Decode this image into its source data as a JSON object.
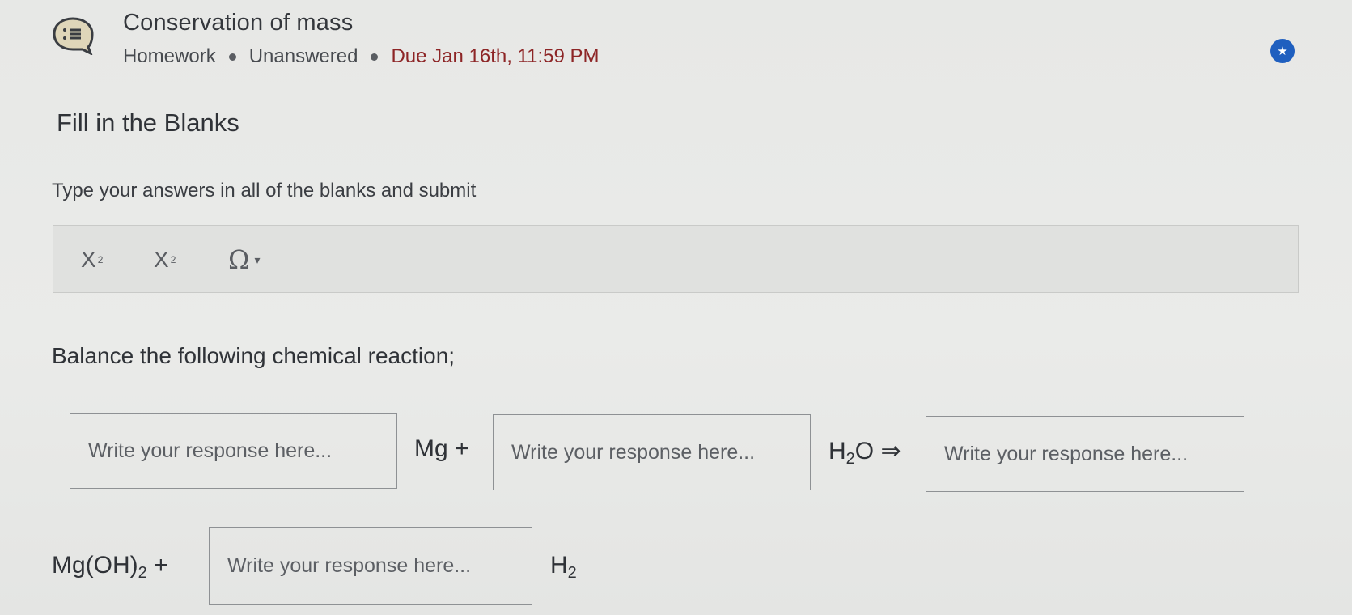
{
  "header": {
    "icon": "question-list-icon",
    "title": "Conservation of mass",
    "type": "Homework",
    "status": "Unanswered",
    "due": "Due Jan 16th, 11:59 PM",
    "star_icon": "star-icon",
    "due_color": "#8d2526",
    "accent_color": "#1f5fbf"
  },
  "section_title": "Fill in the Blanks",
  "instructions": "Type your answers in all of the blanks and submit",
  "toolbar": {
    "subscript_label": "X",
    "subscript_mark": "2",
    "superscript_label": "X",
    "superscript_mark": "2",
    "special_char_label": "Ω",
    "special_char_caret": "▾"
  },
  "question": {
    "prompt": "Balance the following chemical reaction;",
    "placeholder": "Write your response here...",
    "mg": "Mg +",
    "h2o_main": "H",
    "h2o_sub": "2",
    "h2o_rest": "O ⇒",
    "mgoh_main": "Mg(OH)",
    "mgoh_sub": "2",
    "mgoh_rest": " +",
    "h2_main": "H",
    "h2_sub": "2"
  }
}
